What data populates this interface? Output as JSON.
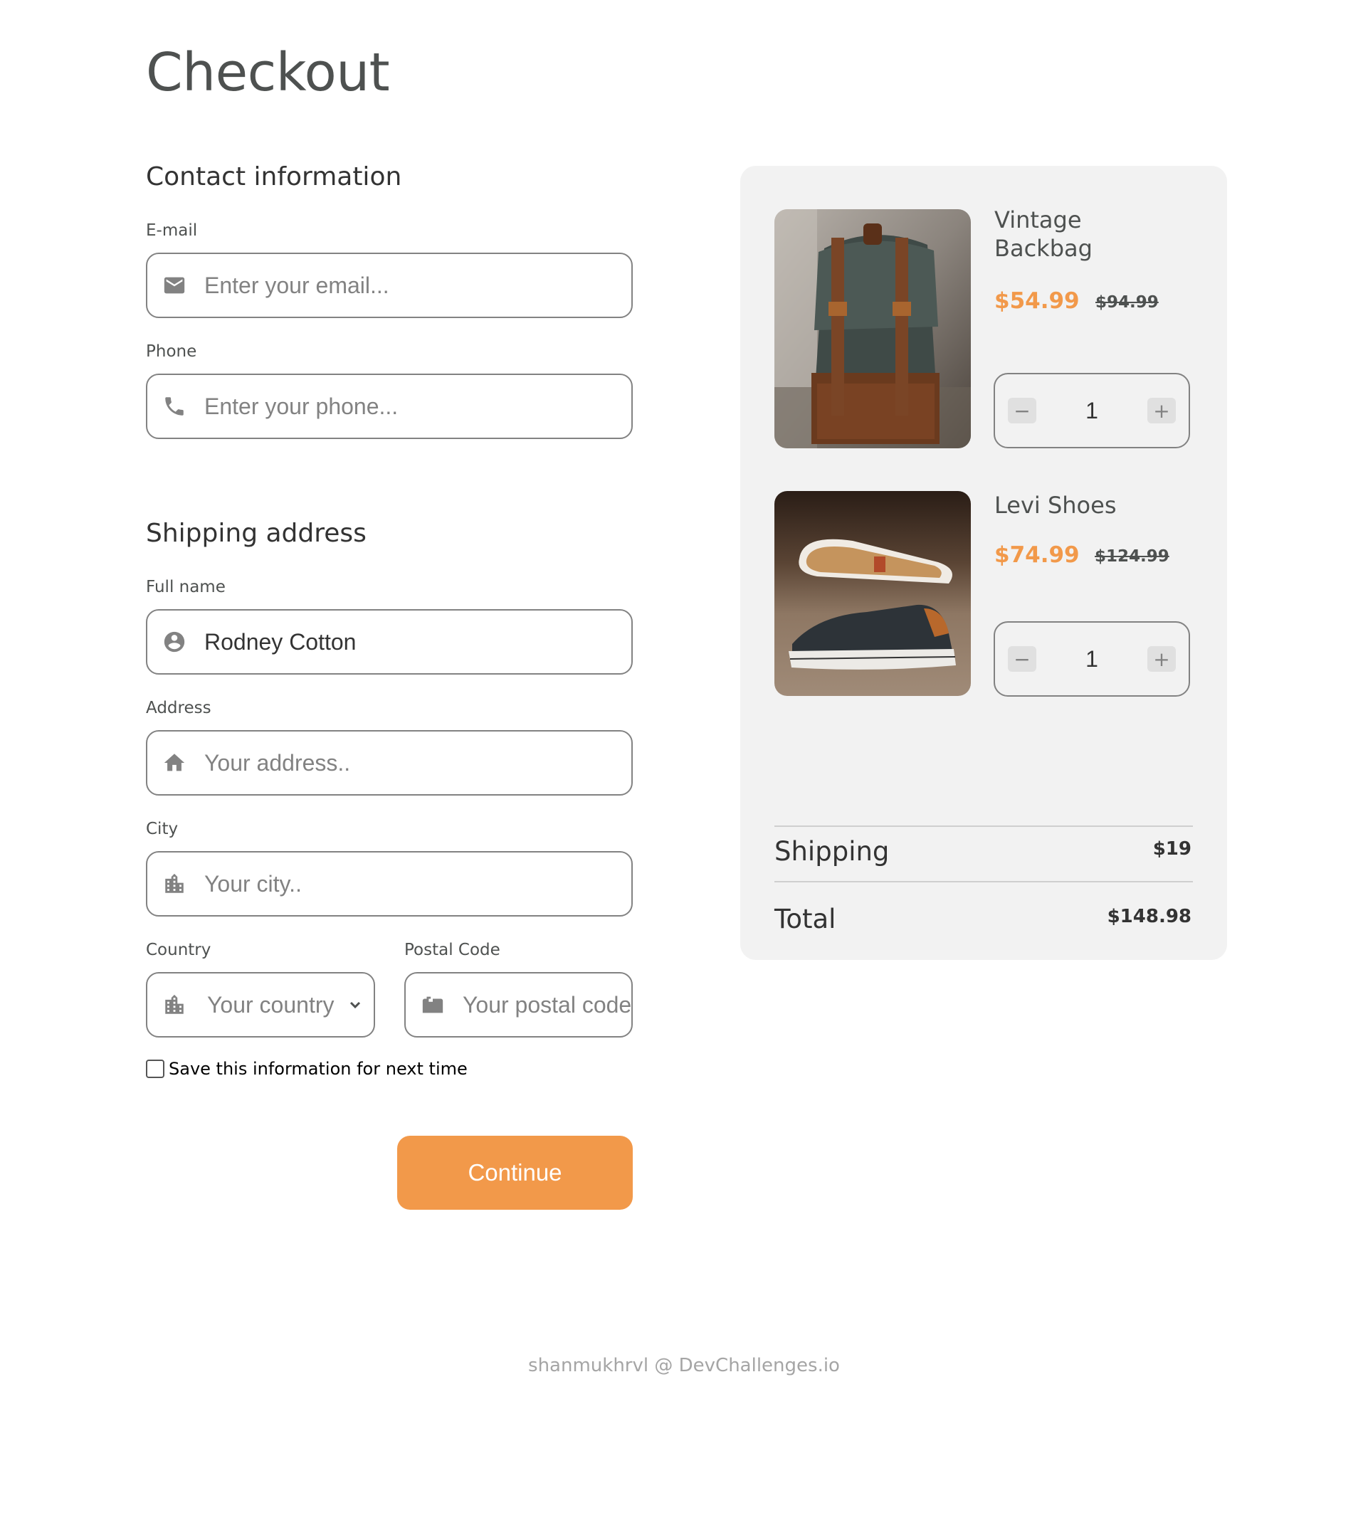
{
  "page": {
    "title": "Checkout"
  },
  "contact": {
    "title": "Contact information",
    "email": {
      "label": "E-mail",
      "placeholder": "Enter your email..."
    },
    "phone": {
      "label": "Phone",
      "placeholder": "Enter your phone..."
    }
  },
  "shipping": {
    "title": "Shipping address",
    "full_name": {
      "label": "Full name",
      "value": "Rodney Cotton"
    },
    "address": {
      "label": "Address",
      "placeholder": "Your address.."
    },
    "city": {
      "label": "City",
      "placeholder": "Your city.."
    },
    "country": {
      "label": "Country",
      "selected": "Your country"
    },
    "postal": {
      "label": "Postal Code",
      "placeholder": "Your postal code"
    },
    "save_label": "Save this information for next time",
    "save_checked": false
  },
  "actions": {
    "continue_label": "Continue"
  },
  "cart": {
    "items": [
      {
        "name_line1": "Vintage",
        "name_line2": "Backbag",
        "price": "$54.99",
        "old_price": "$94.99",
        "quantity": "1",
        "minus": "−",
        "plus": "+"
      },
      {
        "name": "Levi Shoes",
        "price": "$74.99",
        "old_price": "$124.99",
        "quantity": "1",
        "minus": "−",
        "plus": "+"
      }
    ],
    "shipping_label": "Shipping",
    "shipping_value": "$19",
    "total_label": "Total",
    "total_value": "$148.98"
  },
  "footer": {
    "credit": "shanmukhrvl @ DevChallenges.io"
  },
  "colors": {
    "accent": "#f2994a",
    "panel": "#f2f2f2",
    "border": "#828282",
    "text": "#333333"
  }
}
